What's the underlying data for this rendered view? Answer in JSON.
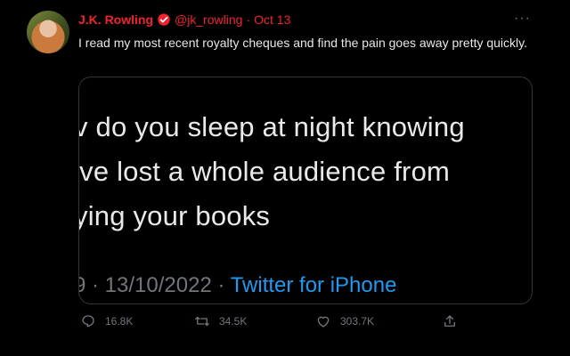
{
  "tweet": {
    "author_name": "J.K. Rowling",
    "handle": "@jk_rowling",
    "separator": "·",
    "date": "Oct 13",
    "more": "···",
    "text": "I read my most recent royalty cheques and find the pain goes away pretty quickly.",
    "media": {
      "lines": [
        "v do you sleep at night knowing",
        "'ve lost a whole audience from",
        "ying your books"
      ],
      "meta_prefix": "9 · 13/10/2022 · ",
      "meta_via": "Twitter for iPhone"
    },
    "actions": {
      "reply_count": "16.8K",
      "retweet_count": "34.5K",
      "like_count": "303.7K"
    },
    "colors": {
      "name_accent": "#f4212e",
      "link_blue": "#1d9bf0",
      "muted": "#71767b"
    },
    "icons": [
      "verified-badge-icon",
      "more-icon",
      "reply-icon",
      "retweet-icon",
      "like-icon",
      "share-icon"
    ]
  }
}
